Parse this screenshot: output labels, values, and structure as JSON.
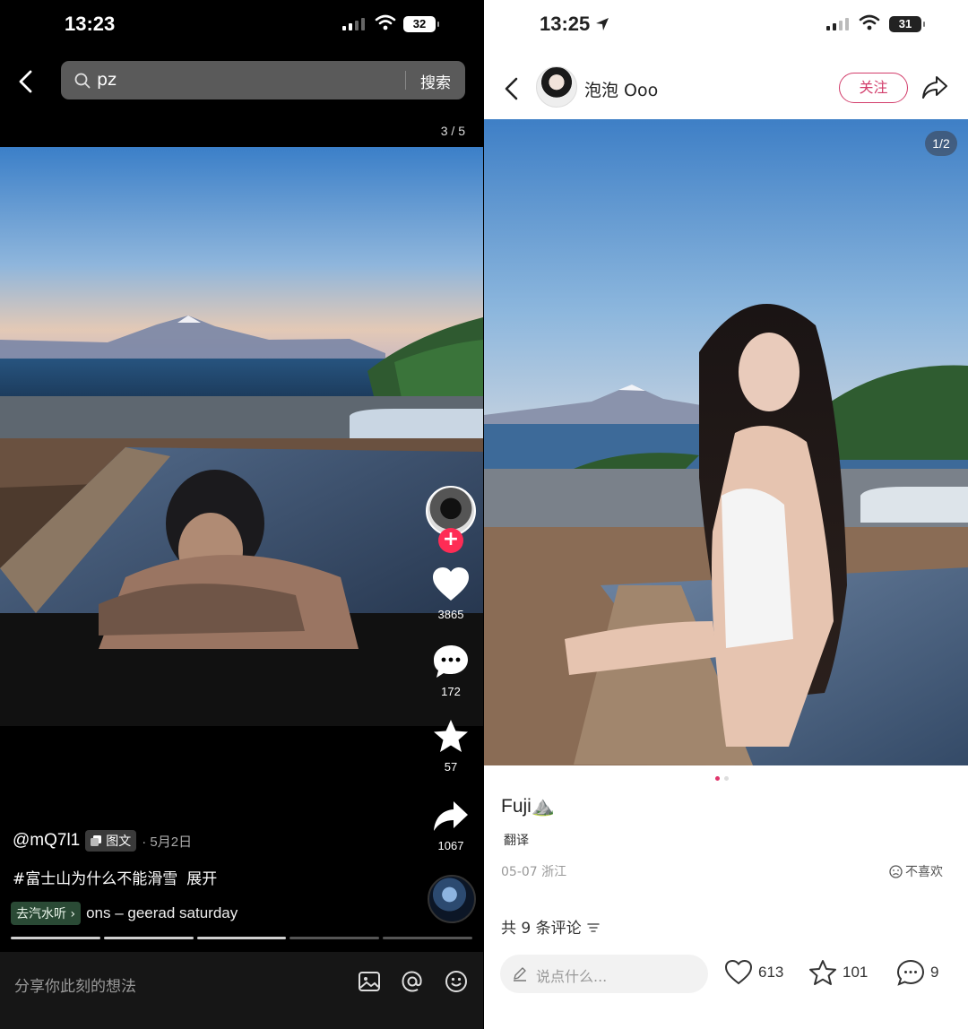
{
  "left": {
    "status": {
      "time": "13:23",
      "battery": "32"
    },
    "search": {
      "query": "pz",
      "button": "搜索"
    },
    "counter": "3 / 5",
    "rail": {
      "likes": "3865",
      "comments": "172",
      "favorites": "57",
      "shares": "1067"
    },
    "author": "@mQ7l1",
    "post_type": "图文",
    "date": "· 5月2日",
    "description": "#富士山为什么不能滑雪",
    "expand": "展开",
    "music_chip": "去汽水听 ›",
    "music_title": "ons – geerad   saturday",
    "progress": {
      "total": 5,
      "current": 3
    },
    "comment_placeholder": "分享你此刻的想法"
  },
  "right": {
    "status": {
      "time": "13:25",
      "battery": "31"
    },
    "username": "泡泡 Ooo",
    "follow": "关注",
    "counter": "1/2",
    "pager": {
      "total": 2,
      "current": 1
    },
    "title": "Fuji⛰️",
    "translate": "翻译",
    "meta": "05-07 浙江",
    "dislike": "不喜欢",
    "comments_count": "共 9 条评论",
    "input_placeholder": "说点什么...",
    "likes": "613",
    "favorites": "101",
    "comments": "9"
  },
  "colors": {
    "accent_red": "#fe2c55",
    "follow_pink": "#d23d6b"
  },
  "icons": [
    "back-arrow-icon",
    "search-icon",
    "heart-icon",
    "comment-icon",
    "star-icon",
    "share-icon",
    "image-icon",
    "at-icon",
    "emoji-icon",
    "location-arrow-icon",
    "wifi-icon",
    "signal-icon",
    "battery-icon",
    "pencil-icon",
    "sad-face-icon",
    "filter-icon"
  ]
}
